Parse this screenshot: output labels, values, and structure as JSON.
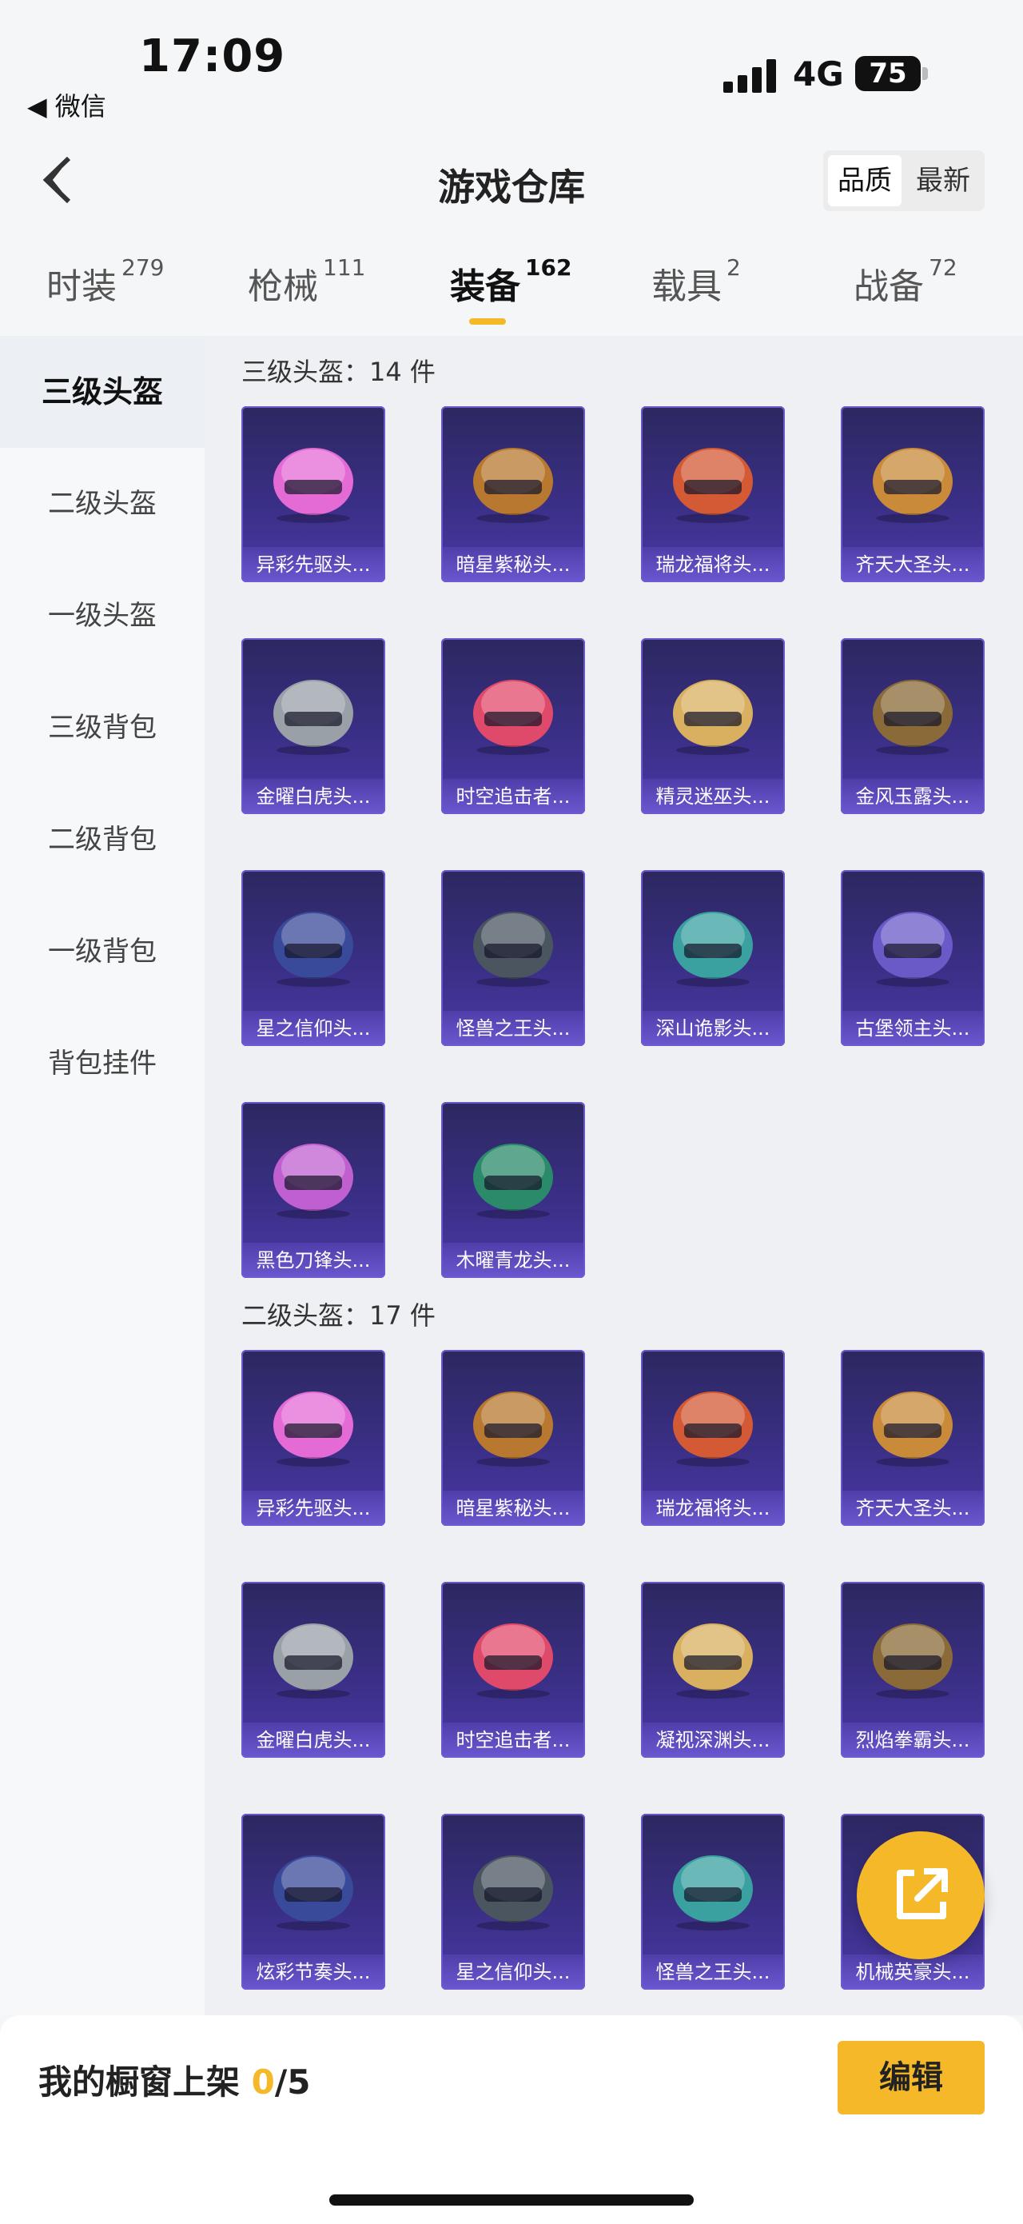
{
  "status": {
    "time": "17:09",
    "back_app": "◀ 微信",
    "network": "4G",
    "battery": "75"
  },
  "header": {
    "title": "游戏仓库",
    "sort_options": [
      "品质",
      "最新"
    ]
  },
  "tabs": [
    {
      "label": "时装",
      "count": "279"
    },
    {
      "label": "枪械",
      "count": "111"
    },
    {
      "label": "装备",
      "count": "162"
    },
    {
      "label": "载具",
      "count": "2"
    },
    {
      "label": "战备",
      "count": "72"
    }
  ],
  "sidebar": [
    "三级头盔",
    "二级头盔",
    "一级头盔",
    "三级背包",
    "二级背包",
    "一级背包",
    "背包挂件"
  ],
  "sections": [
    {
      "title": "三级头盔：14 件",
      "items": [
        "异彩先驱头...",
        "暗星紫秘头...",
        "瑞龙福将头...",
        "齐天大圣头...",
        "金曜白虎头...",
        "时空追击者...",
        "精灵迷巫头...",
        "金风玉露头...",
        "星之信仰头...",
        "怪兽之王头...",
        "深山诡影头...",
        "古堡领主头...",
        "黑色刀锋头...",
        "木曜青龙头..."
      ]
    },
    {
      "title": "二级头盔：17 件",
      "items": [
        "异彩先驱头...",
        "暗星紫秘头...",
        "瑞龙福将头...",
        "齐天大圣头...",
        "金曜白虎头...",
        "时空追击者...",
        "凝视深渊头...",
        "烈焰拳霸头...",
        "炫彩节奏头...",
        "星之信仰头...",
        "怪兽之王头...",
        "机械英豪头..."
      ]
    }
  ],
  "bottom": {
    "label": "我的橱窗上架 ",
    "count": "0",
    "total": "/5",
    "edit": "编辑"
  },
  "colors": {
    "accent": "#f5b829",
    "card_bg": "#3a2f86"
  }
}
